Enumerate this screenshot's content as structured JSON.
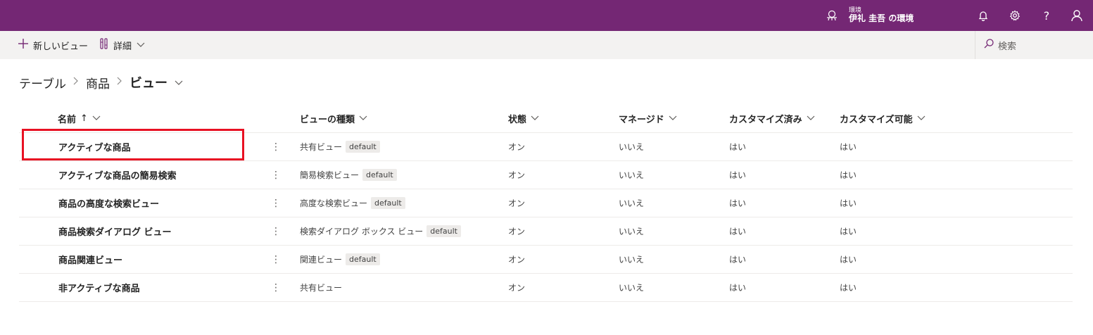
{
  "topbar": {
    "env_label": "環境",
    "env_name": "伊礼 圭吾 の環境",
    "help_label": "?",
    "icons": [
      "environment-icon",
      "bell-icon",
      "gear-icon",
      "help-icon",
      "person-icon"
    ]
  },
  "commandbar": {
    "new_view_label": "新しいビュー",
    "details_label": "詳細",
    "search_placeholder": "検索"
  },
  "breadcrumb": {
    "items": [
      "テーブル",
      "商品",
      "ビュー"
    ]
  },
  "table": {
    "columns": [
      "名前",
      "ビューの種類",
      "状態",
      "マネージド",
      "カスタマイズ済み",
      "カスタマイズ可能"
    ],
    "sort_indicator": "↑",
    "rows": [
      {
        "name": "アクティブな商品",
        "type": "共有ビュー",
        "badge": "default",
        "state": "オン",
        "managed": "いいえ",
        "customized": "はい",
        "customizable": "はい"
      },
      {
        "name": "アクティブな商品の簡易検索",
        "type": "簡易検索ビュー",
        "badge": "default",
        "state": "オン",
        "managed": "いいえ",
        "customized": "はい",
        "customizable": "はい"
      },
      {
        "name": "商品の高度な検索ビュー",
        "type": "高度な検索ビュー",
        "badge": "default",
        "state": "オン",
        "managed": "いいえ",
        "customized": "はい",
        "customizable": "はい"
      },
      {
        "name": "商品検索ダイアログ ビュー",
        "type": "検索ダイアログ ボックス ビュー",
        "badge": "default",
        "state": "オン",
        "managed": "いいえ",
        "customized": "はい",
        "customizable": "はい"
      },
      {
        "name": "商品関連ビュー",
        "type": "関連ビュー",
        "badge": "default",
        "state": "オン",
        "managed": "いいえ",
        "customized": "はい",
        "customizable": "はい"
      },
      {
        "name": "非アクティブな商品",
        "type": "共有ビュー",
        "badge": "",
        "state": "オン",
        "managed": "いいえ",
        "customized": "はい",
        "customizable": "はい"
      }
    ]
  },
  "colors": {
    "brand": "#742774",
    "highlight": "#e81123"
  }
}
